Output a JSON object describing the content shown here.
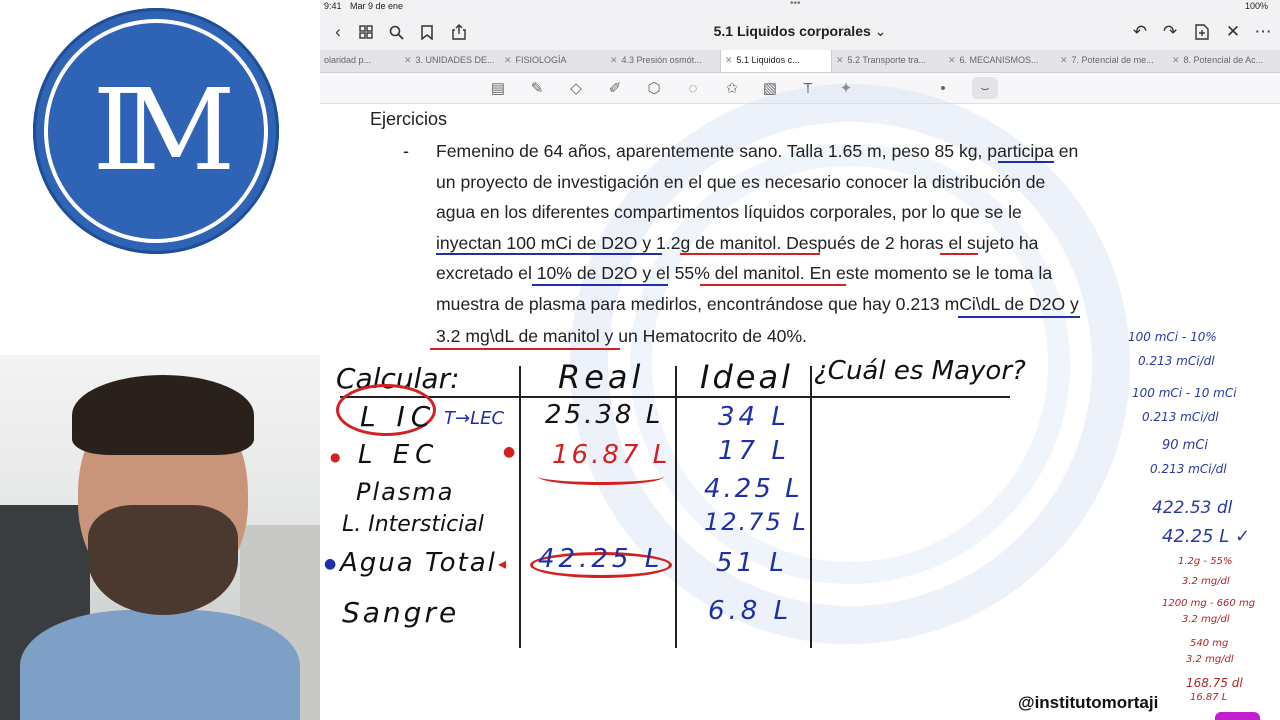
{
  "logo": {
    "text": "IM"
  },
  "status": {
    "time": "9:41",
    "date": "Mar 9 de ene",
    "battery": "100%"
  },
  "app": {
    "title": "5.1 Liquidos corporales",
    "title_suffix": " ⌄"
  },
  "tabs": [
    {
      "label": "olaridad p..."
    },
    {
      "label": "3. UNIDADES DE..."
    },
    {
      "label": "FISIOLOGÍA"
    },
    {
      "label": "4.3 Presión osmót..."
    },
    {
      "label": "5.1 Liquidos c..."
    },
    {
      "label": "5.2 Transporte tra..."
    },
    {
      "label": "6. MECANISMOS..."
    },
    {
      "label": "7. Potencial de me..."
    },
    {
      "label": "8. Potencial de Ac..."
    }
  ],
  "document": {
    "heading": "Ejercicios",
    "bullet": "-",
    "lines": [
      "Femenino de 64 años, aparentemente sano. Talla 1.65 m, peso 85 kg, participa en",
      "un proyecto de investigación en el que es necesario conocer la distribución de",
      "agua en los diferentes compartimentos líquidos corporales, por lo que se le",
      "inyectan 100 mCi de D2O y 1.2g de manitol. Después de 2 horas el sujeto ha",
      "excretado el 10% de D2O y el 55% del manitol. En este momento se le toma la",
      "muestra de plasma para medirlos, encontrándose que hay 0.213 mCi\\dL de D2O y",
      "3.2 mg\\dL de manitol y un Hematocrito de 40%."
    ]
  },
  "table": {
    "headers": {
      "calc": "Calcular:",
      "real": "Real",
      "ideal": "Ideal",
      "mayor": "¿Cuál es Mayor?"
    },
    "rows": [
      {
        "label": "L IC",
        "note": "T→LEC",
        "real": "25.38 L",
        "ideal": "34 L"
      },
      {
        "label": "L EC",
        "real": "16.87 L",
        "ideal": "17 L"
      },
      {
        "label": "Plasma",
        "real": "",
        "ideal": "4.25 L"
      },
      {
        "label": "L. Intersticial",
        "real": "",
        "ideal": "12.75 L"
      },
      {
        "label": "Agua Total",
        "real": "42.25 L",
        "ideal": "51 L"
      },
      {
        "label": "Sangre",
        "real": "",
        "ideal": "6.8 L"
      }
    ]
  },
  "side_notes": [
    "100 mCi - 10%",
    "0.213 mCi/dl",
    "100 mCi - 10 mCi",
    "0.213 mCi/dl",
    "90 mCi",
    "0.213 mCi/dl",
    "422.53 dl",
    "42.25 L ✓",
    "1.2g - 55%",
    "3.2 mg/dl",
    "1200 mg - 660 mg",
    "3.2 mg/dl",
    "540 mg",
    "3.2 mg/dl",
    "168.75 dl",
    "16.87 L"
  ],
  "handle": "@institutomortaji",
  "colors": {
    "ink_blue": "#1e2fa8",
    "ink_red": "#d42020",
    "logo_blue": "#2f63b5"
  }
}
